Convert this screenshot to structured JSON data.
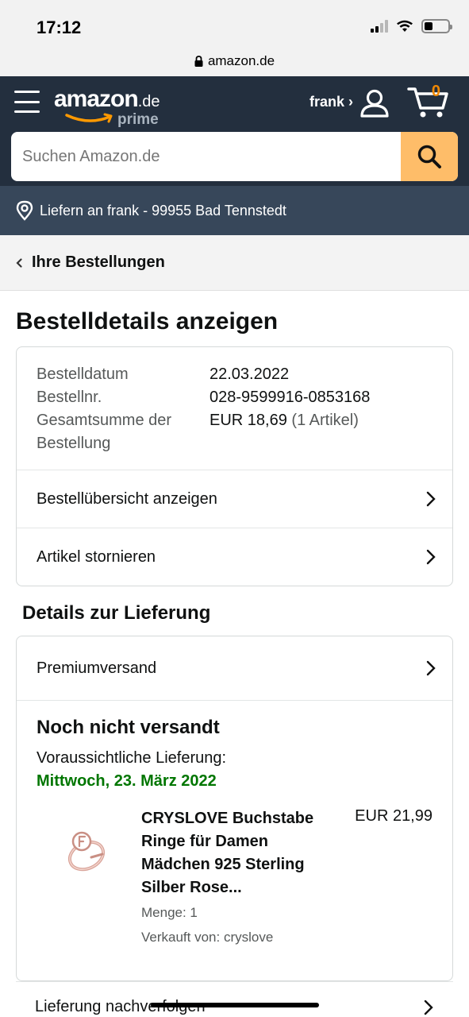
{
  "status_bar": {
    "time": "17:12"
  },
  "browser": {
    "url": "amazon.de"
  },
  "header": {
    "logo_word": "amazon",
    "logo_tld": ".de",
    "logo_sub": "prime",
    "account_label": "frank ›",
    "cart_count": "0"
  },
  "search": {
    "placeholder": "Suchen Amazon.de"
  },
  "delivery_bar": {
    "text": "Liefern an frank - 99955 Bad Tennstedt"
  },
  "breadcrumb": {
    "label": "Ihre Bestellungen"
  },
  "page": {
    "title": "Bestelldetails anzeigen"
  },
  "order_summary": {
    "date_label": "Bestelldatum",
    "date_value": "22.03.2022",
    "number_label": "Bestellnr.",
    "number_value": "028-9599916-0853168",
    "total_label": "Gesamtsumme der Bestellung",
    "total_value": "EUR 18,69",
    "total_items": "(1 Artikel)"
  },
  "order_links": [
    {
      "label": "Bestellübersicht anzeigen"
    },
    {
      "label": "Artikel stornieren"
    }
  ],
  "delivery_section": {
    "title": "Details zur Lieferung",
    "shipping_method": "Premiumversand",
    "status": "Noch nicht versandt",
    "estimate_label": "Voraussichtliche Lieferung:",
    "estimate_date": "Mittwoch, 23. März 2022"
  },
  "item": {
    "name": "CRYSLOVE Buchstabe Ringe für Damen Mädchen 925 Sterling Silber Rose...",
    "quantity": "Menge: 1",
    "seller": "Verkauft von: cryslove",
    "price": "EUR 21,99"
  },
  "tracking": {
    "label": "Lieferung nachverfolgen"
  },
  "colors": {
    "header": "#232f3e",
    "search_button": "#febd69",
    "delivery_bar": "#37475a",
    "date_green": "#007600",
    "cart_orange": "#f08804"
  },
  "icons": [
    "hamburger-icon",
    "user-icon",
    "cart-icon",
    "search-icon",
    "location-pin-icon",
    "lock-icon",
    "chevron-left-icon",
    "chevron-right-icon"
  ]
}
